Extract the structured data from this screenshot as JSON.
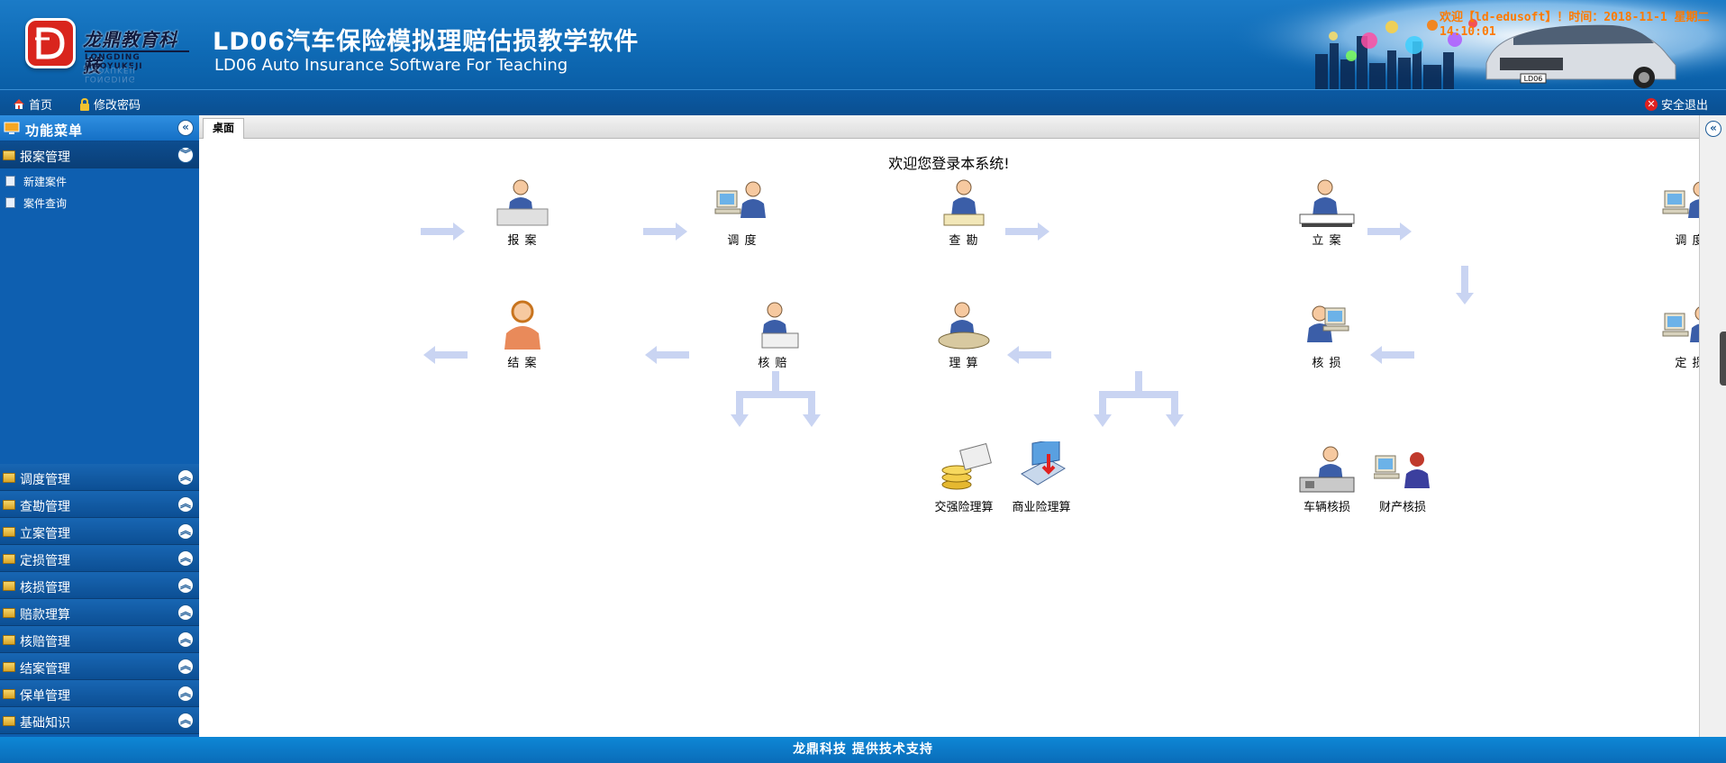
{
  "header": {
    "logo_cn": "龙鼎教育科技",
    "logo_en": "LONGDING JIAOYUKEJI",
    "title_cn": "LD06汽车保险模拟理赔估损教学软件",
    "title_en": "LD06 Auto Insurance Software For Teaching",
    "welcome": "欢迎【ld-edusoft】！时间：2018-11-1 星期二 14:10:01",
    "car_plate": "LD06"
  },
  "topnav": {
    "home": "首页",
    "change_password": "修改密码",
    "logout": "安全退出"
  },
  "sidebar": {
    "title": "功能菜单",
    "open_menu": {
      "label": "报案管理",
      "items": [
        {
          "label": "新建案件"
        },
        {
          "label": "案件查询"
        }
      ]
    },
    "menus": [
      {
        "label": "调度管理"
      },
      {
        "label": "查勘管理"
      },
      {
        "label": "立案管理"
      },
      {
        "label": "定损管理"
      },
      {
        "label": "核损管理"
      },
      {
        "label": "赔款理算"
      },
      {
        "label": "核赔管理"
      },
      {
        "label": "结案管理"
      },
      {
        "label": "保单管理"
      },
      {
        "label": "基础知识"
      }
    ]
  },
  "tabs": [
    {
      "label": "桌面"
    }
  ],
  "main": {
    "welcome": "欢迎您登录本系统!",
    "flow": {
      "report": "报 案",
      "dispatch1": "调 度",
      "survey": "查 勘",
      "register": "立 案",
      "dispatch2": "调 度",
      "close": "结 案",
      "verify_claim": "核 赔",
      "adjust": "理 算",
      "verify_loss": "核 损",
      "assess_loss": "定 损",
      "compulsory_adjust": "交强险理算",
      "commercial_adjust": "商业险理算",
      "vehicle_loss": "车辆核损",
      "property_loss": "财产核损"
    }
  },
  "footer": {
    "text": "龙鼎科技 提供技术支持"
  },
  "colors": {
    "header_blue": "#0f6bb6",
    "sidebar_blue": "#0e5fb0",
    "welcome_orange": "#ff7a00",
    "arrow_color": "#c9d4f2",
    "logo_red": "#d9251d"
  }
}
